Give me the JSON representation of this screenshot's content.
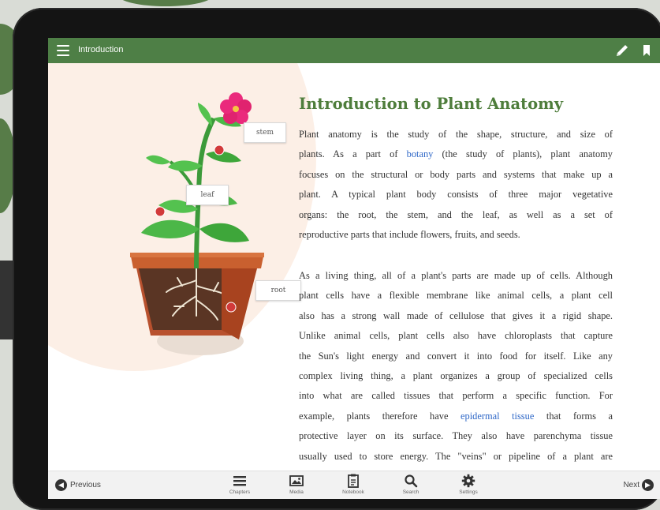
{
  "topbar": {
    "title": "Introduction",
    "menu_icon": "hamburger-menu-icon",
    "edit_icon": "pencil-icon",
    "bookmark_icon": "bookmark-icon",
    "accent_color": "#4e7f46"
  },
  "illustration": {
    "labels": {
      "stem": "stem",
      "leaf": "leaf",
      "root": "root"
    }
  },
  "article": {
    "title": "Introduction to Plant Anatomy",
    "title_color": "#4e7d3b",
    "link_color": "#2e67c7",
    "paragraph1": {
      "l1": "Plant anatomy is the study of the shape, structure, and size of",
      "l2_pre": "plants. As a part of ",
      "l2_link": "botany",
      "l2_post": " (the study of plants), plant anatomy",
      "l3": "focuses on the structural or body parts and systems that make up a",
      "l4": "plant. A typical plant body consists of three major vegetative",
      "l5": "organs: the root, the stem, and the leaf, as well as a set of",
      "l6": "reproductive parts that include flowers, fruits, and seeds."
    },
    "paragraph2": {
      "l1": "As a living thing, all of a plant's parts are made up of cells. Although",
      "l2": "plant cells have a flexible membrane like animal cells, a plant cell",
      "l3": "also has a strong wall made of cellulose that gives it a rigid shape.",
      "l4": "Unlike animal cells, plant cells also have chloroplasts that capture",
      "l5": "the Sun's light energy and convert it into food for itself. Like any",
      "l6": "complex living thing, a plant organizes a group of specialized cells",
      "l7": "into what are called tissues that perform a specific function. For",
      "l8_pre": "example, plants therefore have ",
      "l8_link": "epidermal tissue",
      "l8_post": " that forms a",
      "l9": "protective layer on its surface. They also have parenchyma tissue",
      "l10": "usually used to store energy. The \"veins\" or pipeline of a plant are"
    }
  },
  "bottombar": {
    "previous": "Previous",
    "next": "Next",
    "tools": [
      {
        "label": "Chapters",
        "icon": "chapters-list-icon"
      },
      {
        "label": "Media",
        "icon": "media-image-icon"
      },
      {
        "label": "Notebook",
        "icon": "notebook-icon"
      },
      {
        "label": "Search",
        "icon": "search-icon"
      },
      {
        "label": "Settings",
        "icon": "gear-icon"
      }
    ]
  }
}
